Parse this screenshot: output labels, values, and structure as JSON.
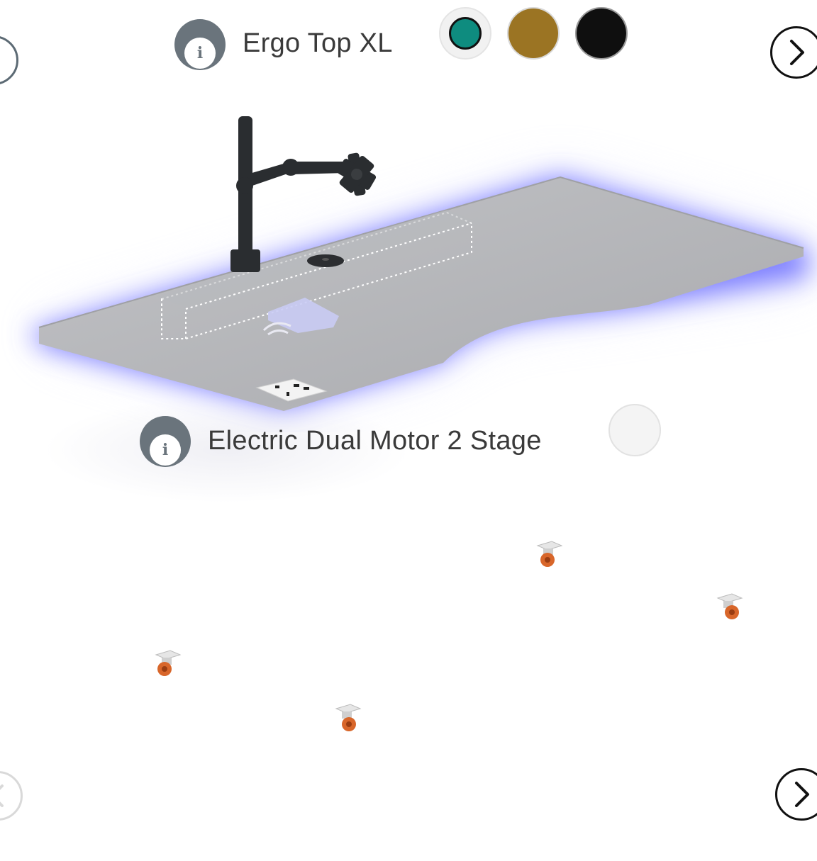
{
  "top_option": {
    "title": "Ergo Top XL",
    "info_icon": "info-icon",
    "swatches": [
      {
        "name": "teal",
        "color": "#0e8c7f",
        "selected": true
      },
      {
        "name": "gold",
        "color": "#9b7423",
        "selected": false
      },
      {
        "name": "black",
        "color": "#0f0f0f",
        "selected": false
      }
    ]
  },
  "bottom_option": {
    "title": "Electric Dual Motor 2 Stage",
    "info_icon": "info-icon",
    "swatches": [
      {
        "name": "white",
        "color": "#f4f4f4",
        "selected": false
      }
    ]
  },
  "navigation": {
    "prev_icon": "chevron-left-icon",
    "next_icon": "chevron-right-icon"
  },
  "colors": {
    "desk_top": "#b4b5b9",
    "led_glow": "#5a5cff",
    "monitor_arm": "#2a2d30",
    "caster_wheel": "#d8662a",
    "text": "#3a3a3a",
    "info_icon_bg": "#6a747c"
  },
  "icons": {
    "info": "info-icon",
    "monitor_arm": "monitor-arm-icon",
    "wireless_charger": "wireless-charger-icon",
    "power_socket": "power-socket-icon",
    "cable_grommet": "cable-grommet-icon",
    "caster": "caster-wheel-icon"
  }
}
